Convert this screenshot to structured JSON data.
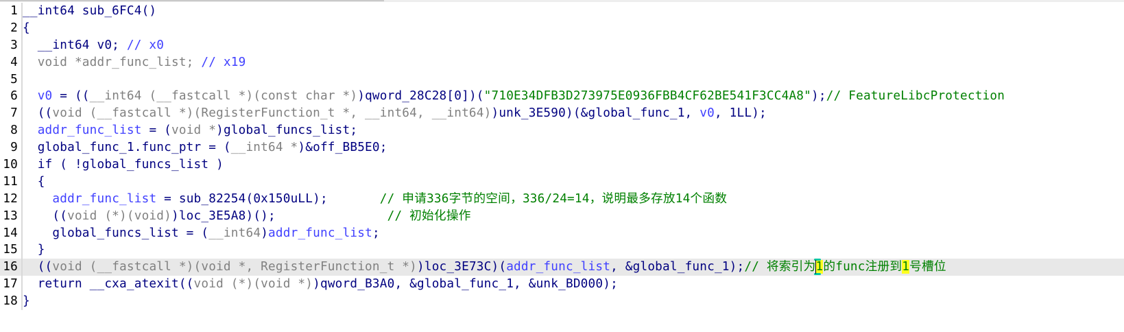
{
  "editor": {
    "lines": [
      {
        "num": "1",
        "tokens": [
          {
            "t": "__int64 sub_6FC4()",
            "c": "t-fn"
          }
        ]
      },
      {
        "num": "2",
        "tokens": [
          {
            "t": "{",
            "c": "t-kw"
          }
        ]
      },
      {
        "num": "3",
        "tokens": [
          {
            "t": "  __int64 v0; ",
            "c": "t-type"
          },
          {
            "t": "// x0",
            "c": "t-lvar"
          }
        ]
      },
      {
        "num": "4",
        "tokens": [
          {
            "t": "  void *addr_func_list; ",
            "c": "t-cast"
          },
          {
            "t": "// x19",
            "c": "t-lvar"
          }
        ]
      },
      {
        "num": "5",
        "tokens": []
      },
      {
        "num": "6",
        "tokens": [
          {
            "t": "  ",
            "c": "t-kw"
          },
          {
            "t": "v0",
            "c": "t-lvar"
          },
          {
            "t": " = ((",
            "c": "t-kw"
          },
          {
            "t": "__int64 (__fastcall *)(const char *)",
            "c": "t-cast"
          },
          {
            "t": ")qword_28C28[0])(",
            "c": "t-glb"
          },
          {
            "t": "\"710E34DFB3D273975E0936FBB4CF62BE541F3CC4A8\"",
            "c": "t-str"
          },
          {
            "t": ");",
            "c": "t-kw"
          },
          {
            "t": "// FeatureLibcProtection",
            "c": "t-cmt"
          }
        ]
      },
      {
        "num": "7",
        "tokens": [
          {
            "t": "  ((",
            "c": "t-kw"
          },
          {
            "t": "void (__fastcall *)(RegisterFunction_t *, __int64, __int64)",
            "c": "t-cast"
          },
          {
            "t": ")unk_3E590)(&global_func_1, ",
            "c": "t-glb"
          },
          {
            "t": "v0",
            "c": "t-lvar"
          },
          {
            "t": ", 1LL);",
            "c": "t-kw"
          }
        ]
      },
      {
        "num": "8",
        "tokens": [
          {
            "t": "  ",
            "c": "t-kw"
          },
          {
            "t": "addr_func_list",
            "c": "t-lvar"
          },
          {
            "t": " = (",
            "c": "t-kw"
          },
          {
            "t": "void *",
            "c": "t-cast"
          },
          {
            "t": ")global_funcs_list;",
            "c": "t-glb"
          }
        ]
      },
      {
        "num": "9",
        "tokens": [
          {
            "t": "  global_func_1.func_ptr = (",
            "c": "t-glb"
          },
          {
            "t": "__int64 *",
            "c": "t-cast"
          },
          {
            "t": ")&off_BB5E0;",
            "c": "t-glb"
          }
        ]
      },
      {
        "num": "10",
        "tokens": [
          {
            "t": "  if ( !global_funcs_list )",
            "c": "t-kw"
          }
        ]
      },
      {
        "num": "11",
        "tokens": [
          {
            "t": "  {",
            "c": "t-kw"
          }
        ]
      },
      {
        "num": "12",
        "tokens": [
          {
            "t": "    ",
            "c": "t-kw"
          },
          {
            "t": "addr_func_list",
            "c": "t-lvar"
          },
          {
            "t": " = sub_82254(0x150uLL);       ",
            "c": "t-glb"
          },
          {
            "t": "// 申请336字节的空间，336/24=14，说明最多存放14个函数",
            "c": "t-cmt"
          }
        ]
      },
      {
        "num": "13",
        "tokens": [
          {
            "t": "    ((",
            "c": "t-kw"
          },
          {
            "t": "void (*)(void)",
            "c": "t-cast"
          },
          {
            "t": ")loc_3E5A8)();               ",
            "c": "t-glb"
          },
          {
            "t": "// 初始化操作",
            "c": "t-cmt"
          }
        ]
      },
      {
        "num": "14",
        "tokens": [
          {
            "t": "    global_funcs_list = (",
            "c": "t-glb"
          },
          {
            "t": "__int64",
            "c": "t-cast"
          },
          {
            "t": ")",
            "c": "t-kw"
          },
          {
            "t": "addr_func_list",
            "c": "t-lvar"
          },
          {
            "t": ";",
            "c": "t-kw"
          }
        ]
      },
      {
        "num": "15",
        "tokens": [
          {
            "t": "  }",
            "c": "t-kw"
          }
        ]
      },
      {
        "num": "16",
        "highlight": true,
        "tokens": [
          {
            "t": "  ((",
            "c": "t-kw"
          },
          {
            "t": "void (__fastcall *)(void *, RegisterFunction_t *)",
            "c": "t-cast"
          },
          {
            "t": ")loc_3E73C)(",
            "c": "t-glb"
          },
          {
            "t": "addr_func_list",
            "c": "t-lvar"
          },
          {
            "t": ", &global_func_1);",
            "c": "t-glb"
          },
          {
            "t": "// 将索引为",
            "c": "t-cmt"
          },
          {
            "t": "1",
            "c": "hl-yellow"
          },
          {
            "t": "的func注册到",
            "c": "t-cmt"
          },
          {
            "t": "1",
            "c": "hl-yellow"
          },
          {
            "t": "号槽位",
            "c": "t-cmt"
          }
        ]
      },
      {
        "num": "17",
        "tokens": [
          {
            "t": "  return __cxa_atexit((",
            "c": "t-kw"
          },
          {
            "t": "void (*)(void *)",
            "c": "t-cast"
          },
          {
            "t": ")qword_B3A0, &global_func_1, &unk_BD000);",
            "c": "t-glb"
          }
        ]
      },
      {
        "num": "18",
        "tokens": [
          {
            "t": "}",
            "c": "t-kw"
          }
        ]
      }
    ]
  }
}
